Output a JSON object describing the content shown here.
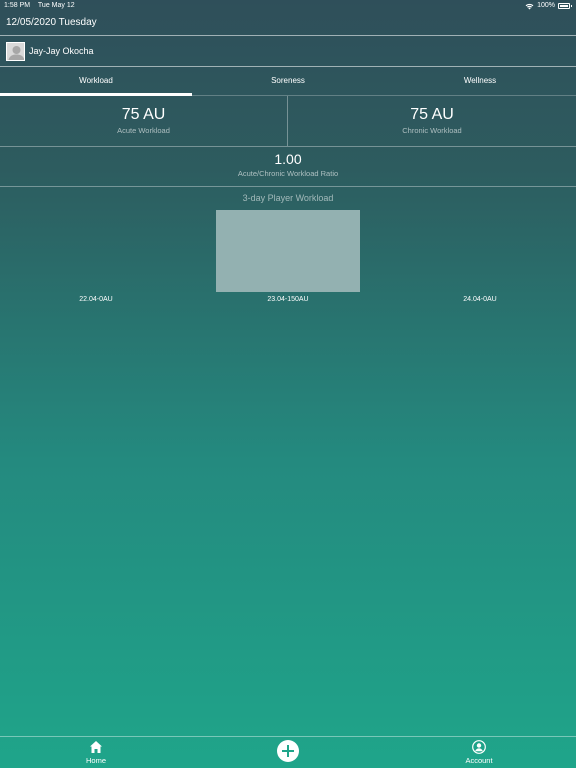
{
  "status_bar": {
    "time": "1:58 PM",
    "date": "Tue May 12",
    "battery": "100%"
  },
  "header": {
    "date": "12/05/2020 Tuesday"
  },
  "player": {
    "name": "Jay-Jay Okocha"
  },
  "tabs": [
    {
      "label": "Workload",
      "active": true
    },
    {
      "label": "Soreness",
      "active": false
    },
    {
      "label": "Wellness",
      "active": false
    }
  ],
  "workload": {
    "acute_value": "75 AU",
    "acute_label": "Acute Workload",
    "chronic_value": "75 AU",
    "chronic_label": "Chronic Workload",
    "ratio_value": "1.00",
    "ratio_label": "Acute/Chronic Workload Ratio"
  },
  "chart_title": "3-day Player Workload",
  "chart_data": {
    "type": "bar",
    "title": "3-day Player Workload",
    "categories": [
      "22.04",
      "23.04",
      "24.04"
    ],
    "values": [
      0,
      150,
      0
    ],
    "labels": [
      "22.04-0AU",
      "23.04-150AU",
      "24.04-0AU"
    ],
    "ylim": [
      0,
      150
    ],
    "bar_color": "#93b1b1"
  },
  "bottom_nav": {
    "home_label": "Home",
    "account_label": "Account"
  }
}
